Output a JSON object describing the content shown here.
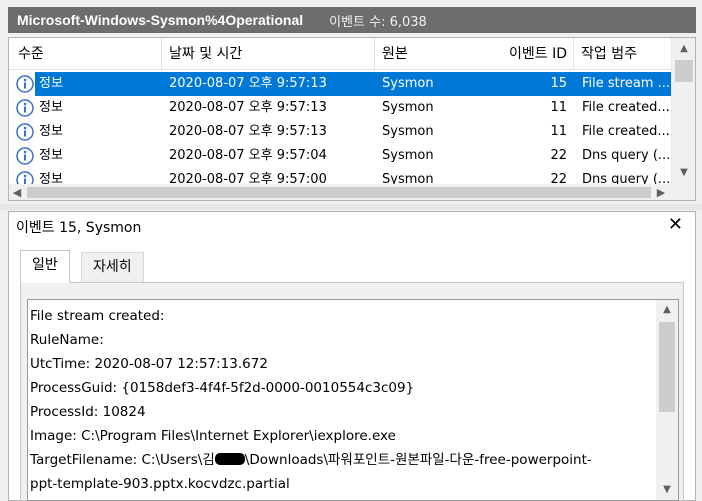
{
  "titlebar": {
    "log_name": "Microsoft-Windows-Sysmon%4Operational",
    "event_count": "이벤트 수: 6,038"
  },
  "list": {
    "columns": [
      "수준",
      "날짜 및 시간",
      "원본",
      "이벤트 ID",
      "작업 범주"
    ],
    "rows": [
      {
        "level": "정보",
        "datetime": "2020-08-07 오후 9:57:13",
        "source": "Sysmon",
        "event_id": "15",
        "category": "File stream ...",
        "selected": true
      },
      {
        "level": "정보",
        "datetime": "2020-08-07 오후 9:57:13",
        "source": "Sysmon",
        "event_id": "11",
        "category": "File created..."
      },
      {
        "level": "정보",
        "datetime": "2020-08-07 오후 9:57:13",
        "source": "Sysmon",
        "event_id": "11",
        "category": "File created..."
      },
      {
        "level": "정보",
        "datetime": "2020-08-07 오후 9:57:04",
        "source": "Sysmon",
        "event_id": "22",
        "category": "Dns query (..."
      },
      {
        "level": "정보",
        "datetime": "2020-08-07 오후 9:57:00",
        "source": "Sysmon",
        "event_id": "22",
        "category": "Dns query (..."
      }
    ],
    "level_icon": "info-icon",
    "accent": "#0078d7"
  },
  "detail": {
    "title": "이벤트 15, Sysmon",
    "tabs": [
      "일반",
      "자세히"
    ],
    "lines": [
      "File stream created:",
      "RuleName:",
      "UtcTime: 2020-08-07 12:57:13.672",
      "ProcessGuid: {0158def3-4f4f-5f2d-0000-0010554c3c09}",
      "ProcessId: 10824",
      "Image: C:\\Program Files\\Internet Explorer\\iexplore.exe"
    ],
    "target_prefix": "TargetFilename: C:\\Users\\김",
    "target_suffix": "\\Downloads\\파워포인트-원본파일-다운-free-powerpoint-",
    "last_line": "ppt-template-903.pptx.kocvdzc.partial"
  }
}
